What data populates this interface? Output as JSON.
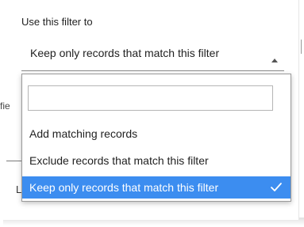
{
  "filter": {
    "label": "Use this filter to",
    "selected_value": "Keep only records that match this filter",
    "search_value": "",
    "options": [
      {
        "label": "Add matching records",
        "selected": false
      },
      {
        "label": "Exclude records that match this filter",
        "selected": false
      },
      {
        "label": "Keep only records that match this filter",
        "selected": true
      }
    ]
  },
  "background": {
    "partial_text": "fie",
    "partial_letter": "L"
  },
  "colors": {
    "selected_bg": "#3c8df0",
    "selected_text": "#ffffff",
    "text": "#222222"
  }
}
